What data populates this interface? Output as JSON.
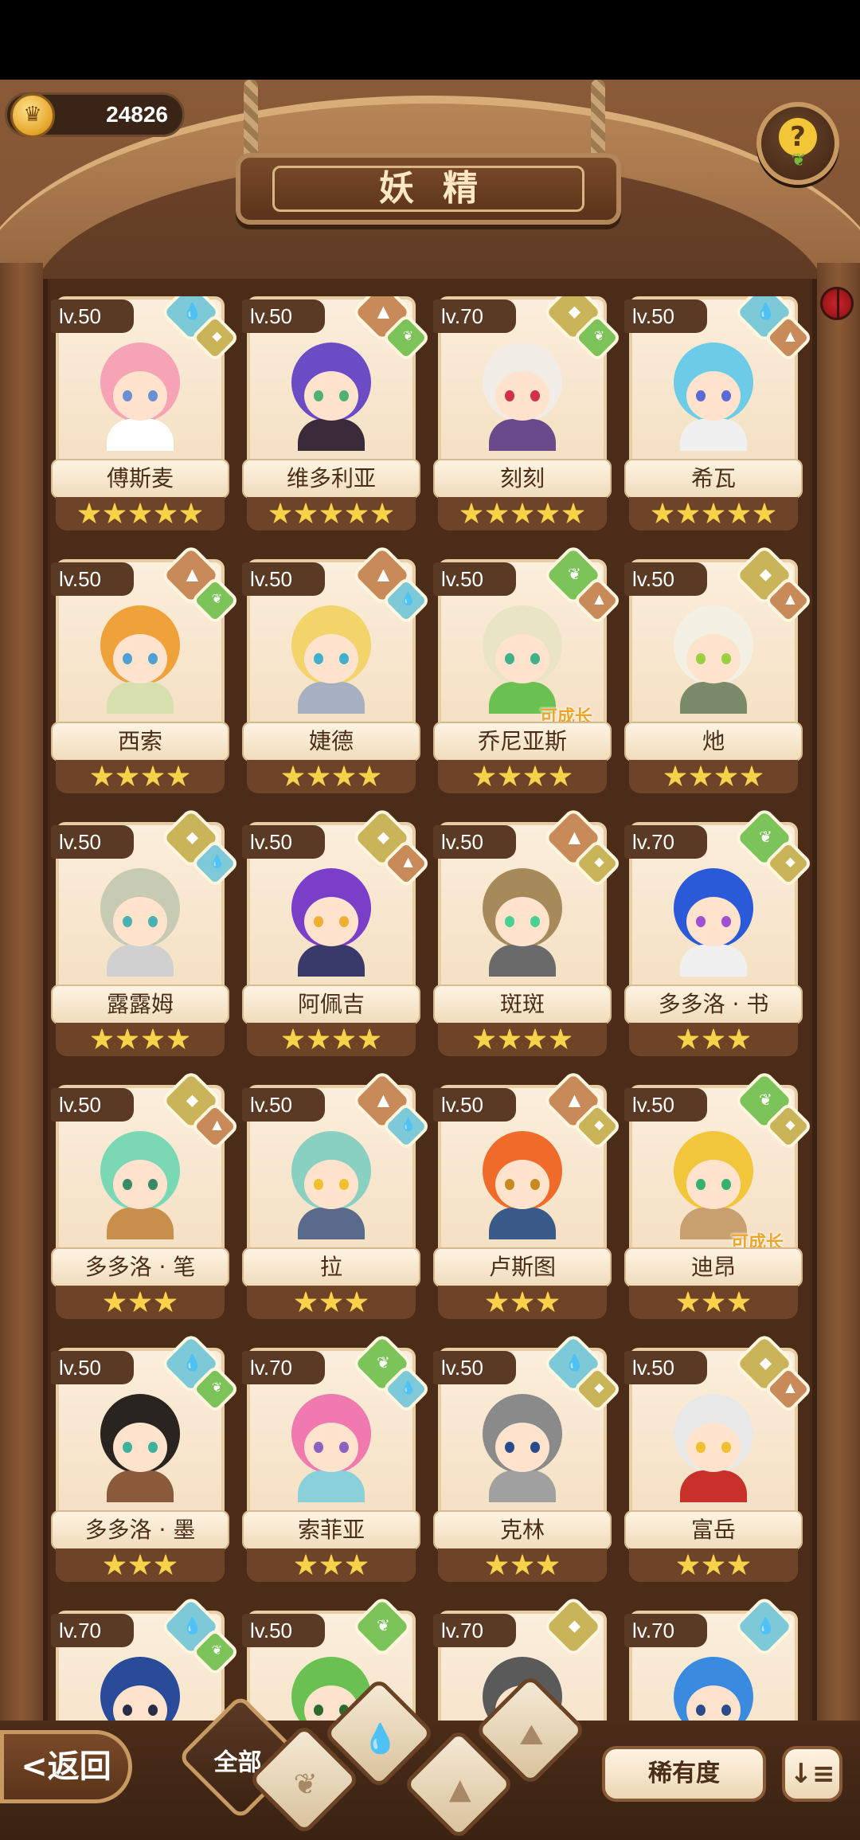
{
  "header": {
    "currency_amount": "24826",
    "title": "妖精",
    "help_symbol": "?"
  },
  "colors": {
    "water": "#7ec9d8",
    "earth": "#c98a5a",
    "plant": "#7cc45a",
    "rock": "#c9b45a",
    "star": "#f7d24a"
  },
  "fairies": [
    {
      "name": "傅斯麦",
      "level": "lv.50",
      "stars": 5,
      "badge1": "water",
      "badge2": "rock",
      "hair": "#f6a3b5",
      "eye": "#6a8fd0",
      "outfit": "#ffffff",
      "grow": ""
    },
    {
      "name": "维多利亚",
      "level": "lv.50",
      "stars": 5,
      "badge1": "earth",
      "badge2": "plant",
      "hair": "#6b4cc4",
      "eye": "#4fb07a",
      "outfit": "#3a2a3a",
      "grow": ""
    },
    {
      "name": "刻刻",
      "level": "lv.70",
      "stars": 5,
      "badge1": "rock",
      "badge2": "plant",
      "hair": "#f1ece6",
      "eye": "#d0304a",
      "outfit": "#6b4a8c",
      "grow": ""
    },
    {
      "name": "希瓦",
      "level": "lv.50",
      "stars": 5,
      "badge1": "water",
      "badge2": "earth",
      "hair": "#6ccbe6",
      "eye": "#5a6ad6",
      "outfit": "#f0f0f0",
      "grow": ""
    },
    {
      "name": "西索",
      "level": "lv.50",
      "stars": 4,
      "badge1": "earth",
      "badge2": "plant",
      "hair": "#f0a23a",
      "eye": "#4fa0d0",
      "outfit": "#d8e0b0",
      "grow": ""
    },
    {
      "name": "婕德",
      "level": "lv.50",
      "stars": 4,
      "badge1": "earth",
      "badge2": "water",
      "hair": "#f2d46a",
      "eye": "#3fb0d0",
      "outfit": "#a6b0c0",
      "grow": ""
    },
    {
      "name": "乔尼亚斯",
      "level": "lv.50",
      "stars": 4,
      "badge1": "plant",
      "badge2": "earth",
      "hair": "#e8e4c4",
      "eye": "#3fb08a",
      "outfit": "#6ac050",
      "grow": "可成长"
    },
    {
      "name": "灺",
      "level": "lv.50",
      "stars": 4,
      "badge1": "rock",
      "badge2": "earth",
      "hair": "#f4f1e4",
      "eye": "#9ad040",
      "outfit": "#7a8a6a",
      "grow": ""
    },
    {
      "name": "露露姆",
      "level": "lv.50",
      "stars": 4,
      "badge1": "rock",
      "badge2": "water",
      "hair": "#c8cbb4",
      "eye": "#4ab0b0",
      "outfit": "#d0d0d0",
      "grow": ""
    },
    {
      "name": "阿佩吉",
      "level": "lv.50",
      "stars": 4,
      "badge1": "rock",
      "badge2": "earth",
      "hair": "#7a3ec8",
      "eye": "#f0b030",
      "outfit": "#3a3a6a",
      "grow": ""
    },
    {
      "name": "斑斑",
      "level": "lv.50",
      "stars": 4,
      "badge1": "earth",
      "badge2": "rock",
      "hair": "#a68a5a",
      "eye": "#4ad090",
      "outfit": "#6a6a6a",
      "grow": ""
    },
    {
      "name": "多多洛 · 书",
      "level": "lv.70",
      "stars": 3,
      "badge1": "plant",
      "badge2": "rock",
      "hair": "#2a5ad8",
      "eye": "#a050d0",
      "outfit": "#f0f0f0",
      "grow": ""
    },
    {
      "name": "多多洛 · 笔",
      "level": "lv.50",
      "stars": 3,
      "badge1": "rock",
      "badge2": "earth",
      "hair": "#7ad8b4",
      "eye": "#3a8a6a",
      "outfit": "#c8904a",
      "grow": ""
    },
    {
      "name": "拉",
      "level": "lv.50",
      "stars": 3,
      "badge1": "earth",
      "badge2": "water",
      "hair": "#8ad0c0",
      "eye": "#f0c030",
      "outfit": "#5a6a8a",
      "grow": ""
    },
    {
      "name": "卢斯图",
      "level": "lv.50",
      "stars": 3,
      "badge1": "earth",
      "badge2": "rock",
      "hair": "#f06a2a",
      "eye": "#c88a20",
      "outfit": "#3a5a8a",
      "grow": ""
    },
    {
      "name": "迪昂",
      "level": "lv.50",
      "stars": 3,
      "badge1": "plant",
      "badge2": "rock",
      "hair": "#f2c63a",
      "eye": "#3ab070",
      "outfit": "#c8a070",
      "grow": "可成长"
    },
    {
      "name": "多多洛 · 墨",
      "level": "lv.50",
      "stars": 3,
      "badge1": "water",
      "badge2": "plant",
      "hair": "#2a2420",
      "eye": "#3fb0a0",
      "outfit": "#8a5a3a",
      "grow": ""
    },
    {
      "name": "索菲亚",
      "level": "lv.70",
      "stars": 3,
      "badge1": "plant",
      "badge2": "water",
      "hair": "#f07ab0",
      "eye": "#8a60c0",
      "outfit": "#8ad0d8",
      "grow": ""
    },
    {
      "name": "克林",
      "level": "lv.50",
      "stars": 3,
      "badge1": "water",
      "badge2": "rock",
      "hair": "#8a8a8a",
      "eye": "#2a4a8a",
      "outfit": "#a0a0a0",
      "grow": ""
    },
    {
      "name": "富岳",
      "level": "lv.50",
      "stars": 3,
      "badge1": "rock",
      "badge2": "earth",
      "hair": "#e8e8e8",
      "eye": "#f0c030",
      "outfit": "#c8302a",
      "grow": ""
    },
    {
      "name": "",
      "level": "lv.70",
      "stars": 0,
      "badge1": "water",
      "badge2": "plant",
      "hair": "#2a4a9a",
      "eye": "#2a2a4a",
      "outfit": "#3a3a6a",
      "grow": ""
    },
    {
      "name": "",
      "level": "lv.50",
      "stars": 0,
      "badge1": "plant",
      "badge2": "",
      "hair": "#6ac050",
      "eye": "#2a6a2a",
      "outfit": "#5aa040",
      "grow": ""
    },
    {
      "name": "",
      "level": "lv.70",
      "stars": 0,
      "badge1": "rock",
      "badge2": "",
      "hair": "#5a5a5a",
      "eye": "#2a2a2a",
      "outfit": "#6a6a6a",
      "grow": ""
    },
    {
      "name": "",
      "level": "lv.70",
      "stars": 0,
      "badge1": "water",
      "badge2": "",
      "hair": "#3a8ae0",
      "eye": "#2a4a8a",
      "outfit": "#4a6ab0",
      "grow": ""
    }
  ],
  "bottom": {
    "back_label": "返回",
    "back_chevron": "<",
    "filter_all": "全部",
    "filters": [
      "plant",
      "water",
      "earth",
      "rock"
    ],
    "sort_label": "稀有度",
    "order_icon": "↓≡"
  }
}
